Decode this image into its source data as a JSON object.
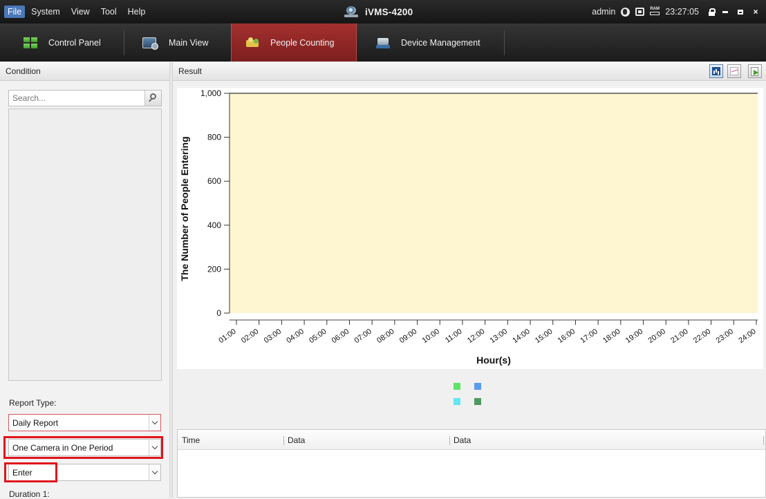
{
  "menu": {
    "items": [
      "File",
      "System",
      "View",
      "Tool",
      "Help"
    ]
  },
  "app": {
    "title": "iVMS-4200"
  },
  "status": {
    "user": "admin",
    "time": "23:27:05",
    "ram_label": "RAM"
  },
  "window_controls": {
    "close": "×"
  },
  "tabs": [
    {
      "label": "Control Panel",
      "icon": "grid-icon",
      "active": false
    },
    {
      "label": "Main View",
      "icon": "monitor-icon",
      "active": false
    },
    {
      "label": "People Counting",
      "icon": "people-counting-icon",
      "active": true
    },
    {
      "label": "Device Management",
      "icon": "device-icon",
      "active": false
    }
  ],
  "condition": {
    "header": "Condition",
    "search_placeholder": "Search...",
    "report_type_label": "Report Type:",
    "report_type_value": "Daily Report",
    "camera_mode_value": "One Camera in One Period",
    "direction_value": "Enter",
    "duration_label": "Duration 1:"
  },
  "result": {
    "header": "Result"
  },
  "chart_data": {
    "type": "bar",
    "ylabel": "The Number of People Entering",
    "xlabel": "Hour(s)",
    "ylim": [
      0,
      1000
    ],
    "y_ticks": [
      "0",
      "200",
      "400",
      "600",
      "800",
      "1,000"
    ],
    "categories": [
      "01:00",
      "02:00",
      "03:00",
      "04:00",
      "05:00",
      "06:00",
      "07:00",
      "08:00",
      "09:00",
      "10:00",
      "11:00",
      "12:00",
      "13:00",
      "14:00",
      "15:00",
      "16:00",
      "17:00",
      "18:00",
      "19:00",
      "20:00",
      "21:00",
      "22:00",
      "23:00",
      "24:00"
    ],
    "series": [],
    "plot_background": "#fdf6d0",
    "legend_colors": [
      "#5ee36a",
      "#5b9bef",
      "#62e6f0",
      "#4f9960"
    ],
    "legend_placement": "bottom-center"
  },
  "table": {
    "columns": [
      "Time",
      "Data",
      "Data"
    ]
  },
  "colors": {
    "active_tab": "#8f2725",
    "highlight": "#e0141c",
    "menu_active": "#4a78b8"
  }
}
